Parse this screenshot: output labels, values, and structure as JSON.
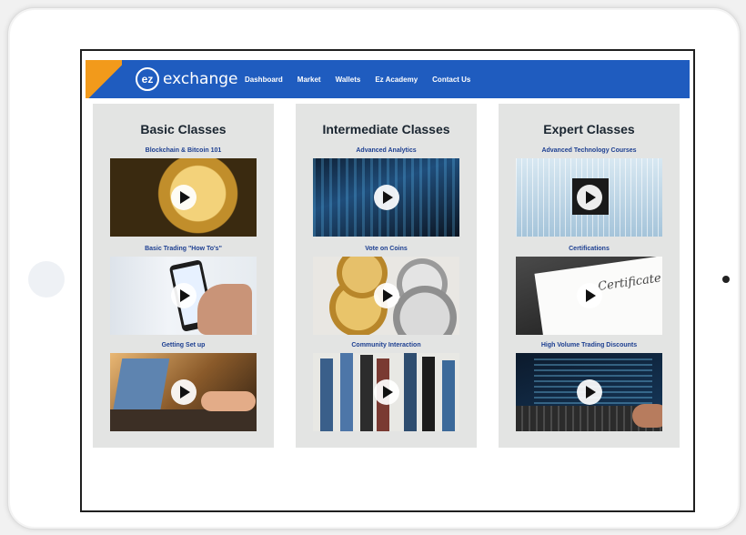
{
  "brand": {
    "badge": "ez",
    "name": "exchange",
    "color_primary": "#1f5cbf",
    "color_accent": "#f29a1b"
  },
  "nav": {
    "items": [
      {
        "label": "Dashboard"
      },
      {
        "label": "Market"
      },
      {
        "label": "Wallets"
      },
      {
        "label": "Ez Academy"
      },
      {
        "label": "Contact Us"
      }
    ]
  },
  "columns": [
    {
      "title": "Basic Classes",
      "items": [
        {
          "title": "Blockchain & Bitcoin 101",
          "icon": "play-icon"
        },
        {
          "title": "Basic Trading  \"How To's\"",
          "icon": "play-icon"
        },
        {
          "title": "Getting Set up",
          "icon": "play-icon"
        }
      ]
    },
    {
      "title": "Intermediate Classes",
      "items": [
        {
          "title": "Advanced Analytics",
          "icon": "play-icon"
        },
        {
          "title": "Vote on Coins",
          "icon": "play-icon"
        },
        {
          "title": "Community Interaction",
          "icon": "play-icon"
        }
      ]
    },
    {
      "title": "Expert Classes",
      "items": [
        {
          "title": "Advanced Technology Courses",
          "icon": "play-icon"
        },
        {
          "title": "Certifications",
          "icon": "play-icon"
        },
        {
          "title": "High Volume Trading Discounts",
          "icon": "play-icon"
        }
      ]
    }
  ],
  "certificate_text": "Certificate of"
}
